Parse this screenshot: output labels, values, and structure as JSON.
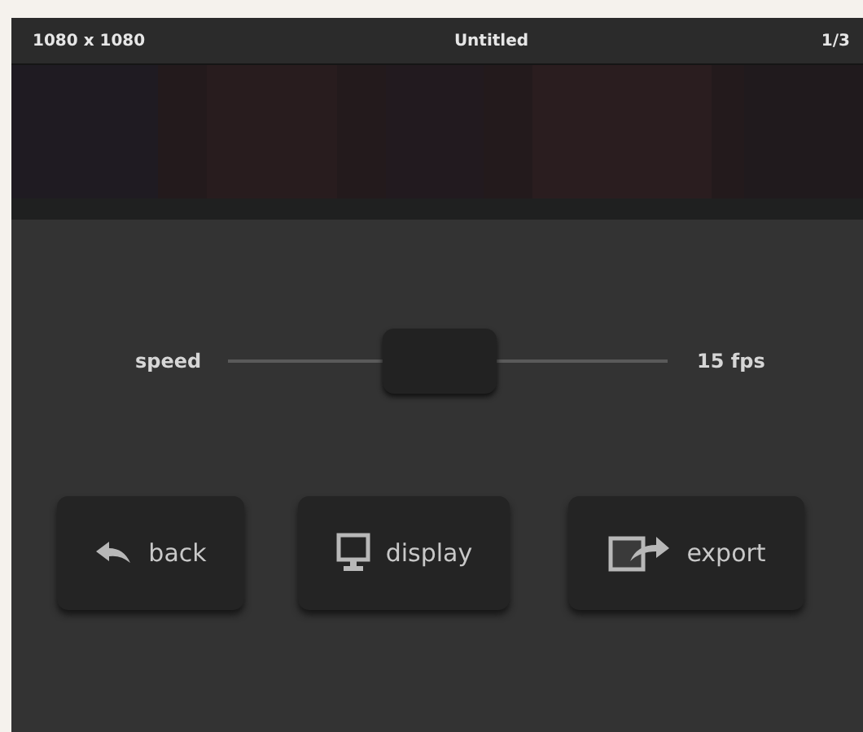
{
  "top_bar": {
    "size": "1080 x 1080",
    "title": "Untitled",
    "page": "1/3"
  },
  "slider": {
    "label": "speed",
    "level": 0.48,
    "reading": "15 fps"
  },
  "buttons": [
    {
      "kind": "back",
      "label": "back"
    },
    {
      "kind": "display",
      "label": "display"
    },
    {
      "kind": "export",
      "label": "export"
    }
  ]
}
